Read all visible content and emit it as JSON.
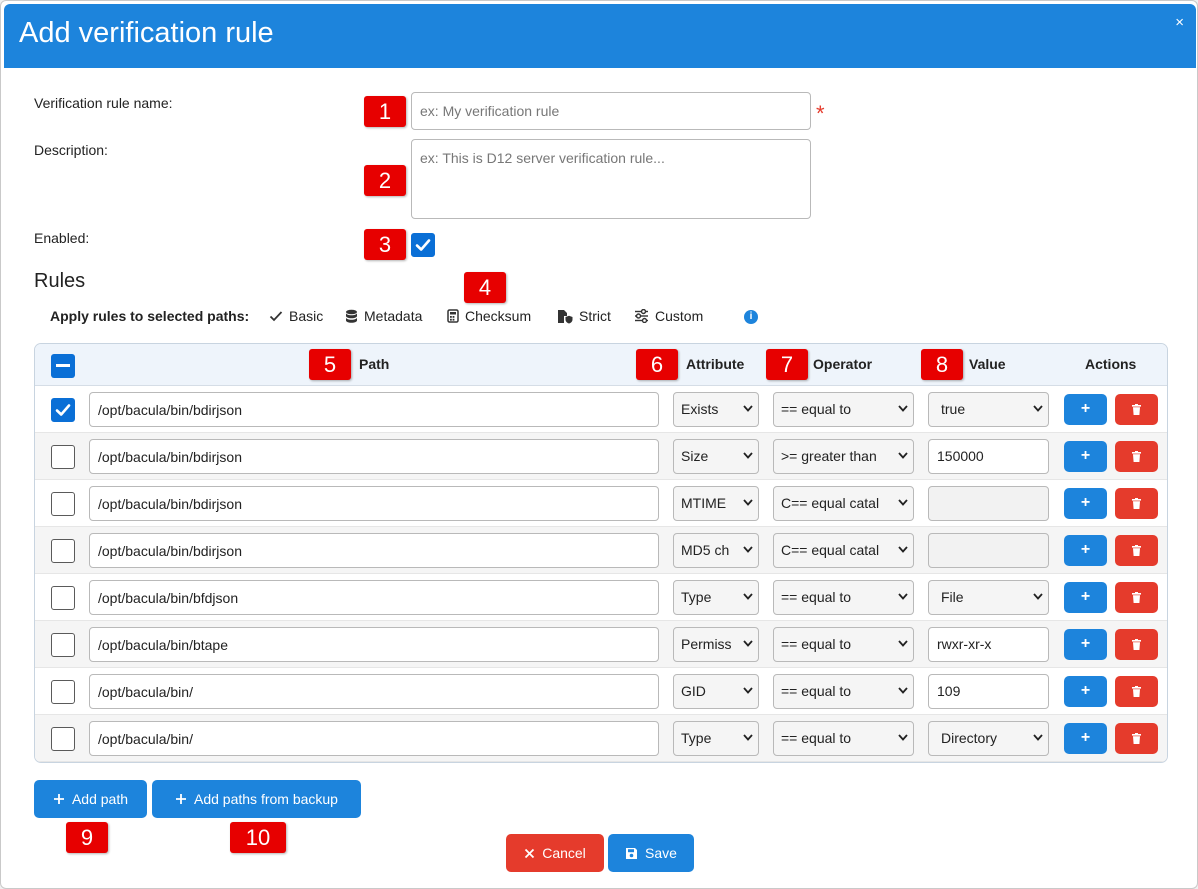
{
  "dialog": {
    "title": "Add verification rule",
    "close_glyph": "×"
  },
  "form": {
    "name_label": "Verification rule name:",
    "name_placeholder": "ex: My verification rule",
    "required_mark": "*",
    "description_label": "Description:",
    "description_placeholder": "ex: This is D12 server verification rule...",
    "enabled_label": "Enabled:",
    "enabled": true
  },
  "rules": {
    "heading": "Rules",
    "apply_label": "Apply rules to selected paths:",
    "presets": [
      {
        "label": "Basic",
        "icon": "check-icon"
      },
      {
        "label": "Metadata",
        "icon": "database-icon"
      },
      {
        "label": "Checksum",
        "icon": "calculator-icon"
      },
      {
        "label": "Strict",
        "icon": "file-shield-icon"
      },
      {
        "label": "Custom",
        "icon": "sliders-icon"
      }
    ],
    "info_icon": "info-icon",
    "columns": {
      "path": "Path",
      "attribute": "Attribute",
      "operator": "Operator",
      "value": "Value",
      "actions": "Actions"
    },
    "add_glyph": "+",
    "rows": [
      {
        "checked": true,
        "path": "/opt/bacula/bin/bdirjson",
        "attribute": "Exists",
        "operator": "== equal to",
        "value": "true",
        "value_type": "select"
      },
      {
        "checked": false,
        "path": "/opt/bacula/bin/bdirjson",
        "attribute": "Size",
        "operator": ">= greater than",
        "value": "150000",
        "value_type": "input"
      },
      {
        "checked": false,
        "path": "/opt/bacula/bin/bdirjson",
        "attribute": "MTIME",
        "operator": "C== equal catal",
        "value": "",
        "value_type": "disabled"
      },
      {
        "checked": false,
        "path": "/opt/bacula/bin/bdirjson",
        "attribute": "MD5 ch",
        "operator": "C== equal catal",
        "value": "",
        "value_type": "disabled"
      },
      {
        "checked": false,
        "path": "/opt/bacula/bin/bfdjson",
        "attribute": "Type",
        "operator": "== equal to",
        "value": "File",
        "value_type": "select"
      },
      {
        "checked": false,
        "path": "/opt/bacula/bin/btape",
        "attribute": "Permiss",
        "operator": "== equal to",
        "value": "rwxr-xr-x",
        "value_type": "input"
      },
      {
        "checked": false,
        "path": "/opt/bacula/bin/",
        "attribute": "GID",
        "operator": "== equal to",
        "value": "109",
        "value_type": "input"
      },
      {
        "checked": false,
        "path": "/opt/bacula/bin/",
        "attribute": "Type",
        "operator": "== equal to",
        "value": "Directory",
        "value_type": "select"
      }
    ]
  },
  "buttons": {
    "add_path": "Add path",
    "add_paths_backup": "Add paths from backup",
    "cancel": "Cancel",
    "save": "Save"
  },
  "annotations": [
    "1",
    "2",
    "3",
    "4",
    "5",
    "6",
    "7",
    "8",
    "9",
    "10"
  ],
  "colors": {
    "primary": "#1d84dc",
    "danger": "#e53b2c",
    "badge": "#e70000"
  }
}
